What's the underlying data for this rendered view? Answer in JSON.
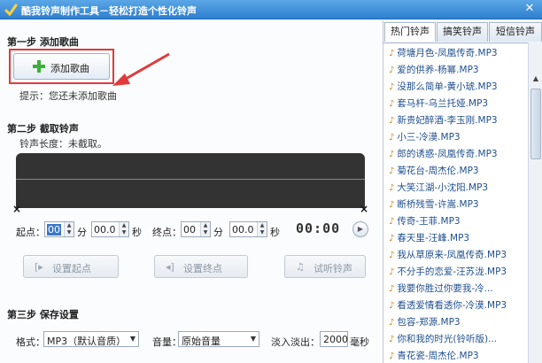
{
  "window": {
    "title": "酷我铃声制作工具－轻松打造个性化铃声",
    "close_glyph": "✕"
  },
  "step1": {
    "title": "第一步  添加歌曲",
    "add_button": "添加歌曲",
    "hint": "提示：您还未添加歌曲"
  },
  "step2": {
    "title": "第二步  截取铃声",
    "ring_length": "铃声长度：未截取。",
    "start_label": "起点：",
    "end_label": "终点：",
    "min_unit": "分",
    "sec_unit": "秒",
    "start_min": "00",
    "start_sec": "00.0",
    "end_min": "00",
    "end_sec": "00.0",
    "timer": "00:00",
    "set_start": "设置起点",
    "set_end": "设置终点",
    "preview": "试听铃声"
  },
  "step3": {
    "title": "第三步  保存设置",
    "format_label": "格式：",
    "format_value": "MP3（默认音质）",
    "volume_label": "音量：",
    "volume_value": "原始音量",
    "fade_label": "淡入淡出：",
    "fade_value": "2000",
    "fade_unit": "毫秒"
  },
  "tabs": [
    "热门铃声",
    "搞笑铃声",
    "短信铃声"
  ],
  "songs": [
    "荷塘月色-凤凰传奇.MP3",
    "爱的供养-杨幂.MP3",
    "没那么简单-黄小琥.MP3",
    "套马杆-乌兰托娅.MP3",
    "新贵妃醉酒-李玉刚.MP3",
    "小三-冷漠.MP3",
    "郎的诱惑-凤凰传奇.MP3",
    "菊花台-周杰伦.MP3",
    "大笑江湖-小沈阳.MP3",
    "断桥残雪-许嵩.MP3",
    "传奇-王菲.MP3",
    "春天里-汪峰.MP3",
    "我从草原来-凤凰传奇.MP3",
    "不分手的恋爱-汪苏泷.MP3",
    "我要你胜过你要我-冷...",
    "看透爱情看透你-冷漠.MP3",
    "包容-郑源.MP3",
    "你和我的时光(铃听版)...",
    "青花瓷-周杰伦.MP3"
  ],
  "colors": {
    "titlebar": "#2f7fcf",
    "highlight": "#e03a3a",
    "song_text": "#1f4f8e",
    "wave": "#333333"
  }
}
